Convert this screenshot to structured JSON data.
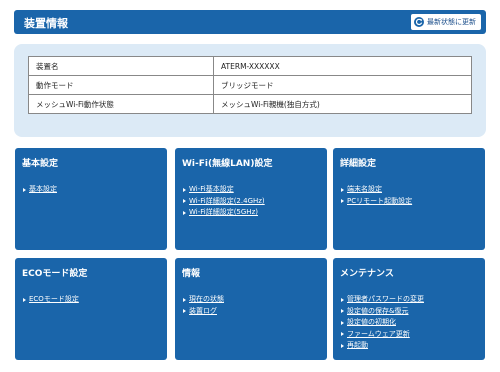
{
  "header": {
    "title": "装置情報",
    "refresh_label": "最新状態に更新"
  },
  "info": {
    "rows": [
      {
        "key": "装置名",
        "value": "ATERM-XXXXXX"
      },
      {
        "key": "動作モード",
        "value": "ブリッジモード"
      },
      {
        "key": "メッシュWi-Fi動作状態",
        "value": "メッシュWi-Fi親機(独自方式)"
      }
    ]
  },
  "cards": [
    {
      "title": "基本設定",
      "links": [
        "基本設定"
      ]
    },
    {
      "title": "Wi-Fi(無線LAN)設定",
      "links": [
        "Wi-Fi基本設定",
        "Wi-Fi詳細設定(2.4GHz)",
        "Wi-Fi詳細設定(5GHz)"
      ]
    },
    {
      "title": "詳細設定",
      "links": [
        "端末名設定",
        "PCリモート起動設定"
      ]
    },
    {
      "title": "ECOモード設定",
      "links": [
        "ECOモード設定"
      ]
    },
    {
      "title": "情報",
      "links": [
        "現在の状態",
        "装置ログ"
      ]
    },
    {
      "title": "メンテナンス",
      "links": [
        "管理者パスワードの変更",
        "設定値の保存&復元",
        "設定値の初期化",
        "ファームウェア更新",
        "再起動"
      ]
    }
  ]
}
